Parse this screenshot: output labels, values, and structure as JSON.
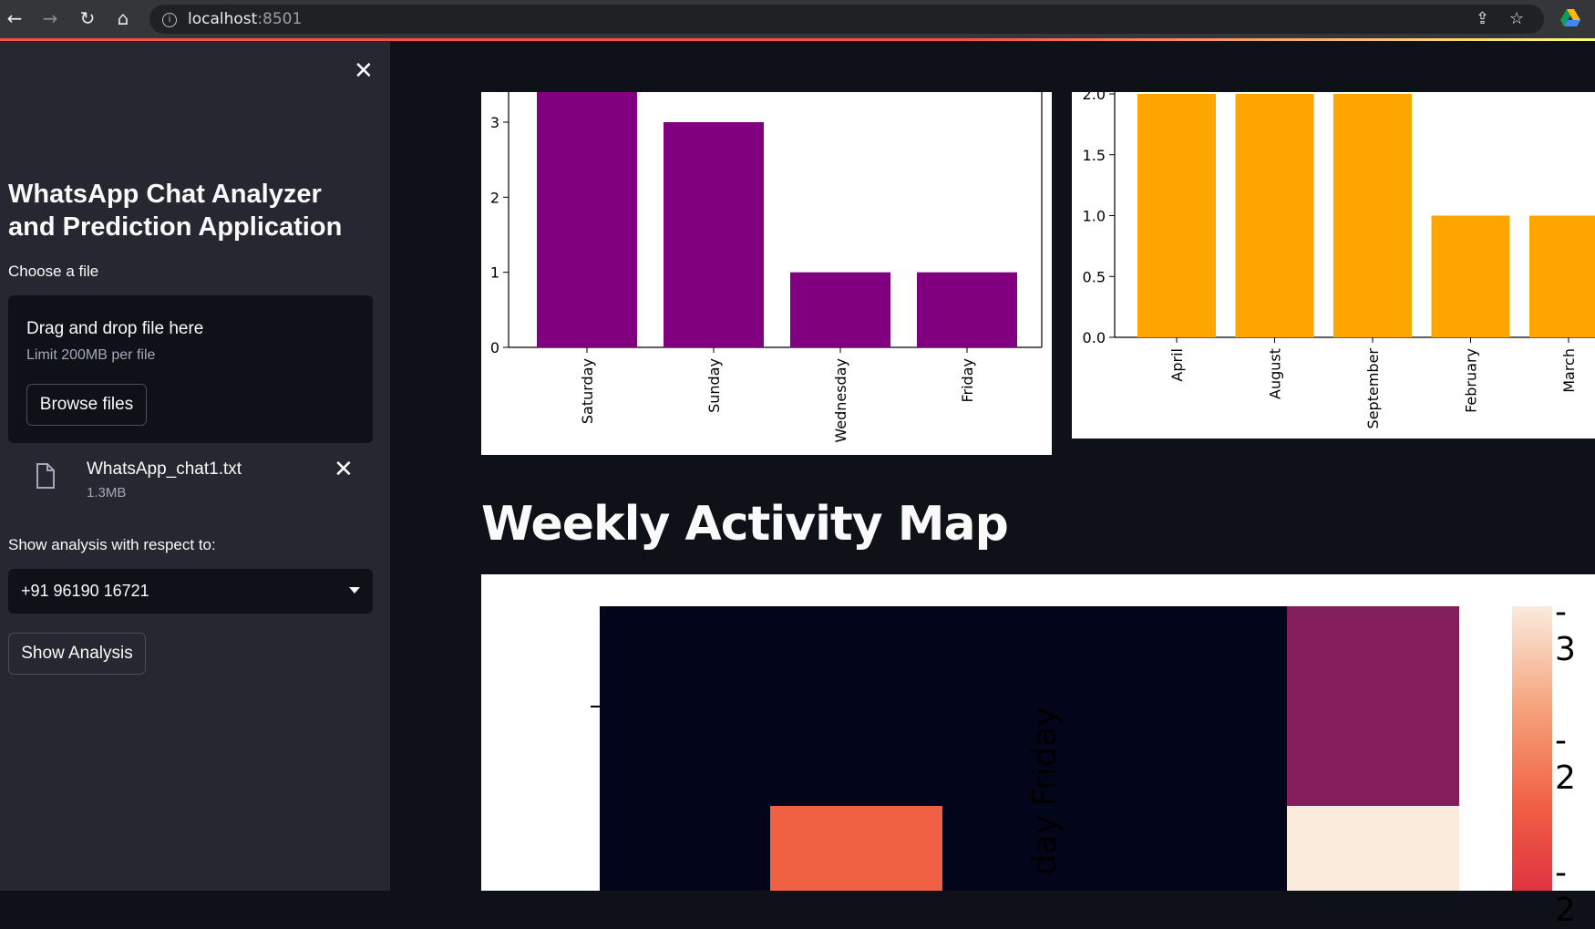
{
  "browser": {
    "url_host": "localhost",
    "url_port": ":8501",
    "icons": [
      "back-icon",
      "forward-icon",
      "reload-icon",
      "home-icon",
      "info-icon",
      "share-icon",
      "star-icon",
      "drive-icon"
    ]
  },
  "sidebar": {
    "title": "WhatsApp Chat Analyzer and Prediction Application",
    "file_label": "Choose a file",
    "dropzone_title": "Drag and drop file here",
    "dropzone_limit": "Limit 200MB per file",
    "browse_label": "Browse files",
    "file_name": "WhatsApp_chat1.txt",
    "file_size": "1.3MB",
    "select_label": "Show analysis with respect to:",
    "select_value": "+91 96190 16721",
    "show_button": "Show Analysis"
  },
  "main": {
    "weekly_title": "Weekly Activity Map"
  },
  "colors": {
    "accent_red": "#ff4b4b",
    "bar_purple": "#800080",
    "bar_orange": "#ffa500"
  },
  "chart_data": [
    {
      "type": "bar",
      "categories": [
        "Saturday",
        "Sunday",
        "Wednesday",
        "Friday"
      ],
      "values": [
        4,
        3,
        1,
        1
      ],
      "yticks": [
        "0",
        "1",
        "2",
        "3"
      ],
      "ylim_visible": [
        0,
        3.3
      ],
      "color": "#800080"
    },
    {
      "type": "bar",
      "categories": [
        "April",
        "August",
        "September",
        "February",
        "March"
      ],
      "values": [
        2,
        2,
        2,
        1,
        1
      ],
      "yticks": [
        "0.0",
        "0.5",
        "1.0",
        "1.5",
        "2.0"
      ],
      "ylim_visible": [
        0,
        2.0
      ],
      "color": "#ffa500"
    },
    {
      "type": "heatmap",
      "row_labels": [
        "Friday",
        "day"
      ],
      "colorbar_ticks": [
        "3",
        "2",
        "2"
      ]
    }
  ]
}
